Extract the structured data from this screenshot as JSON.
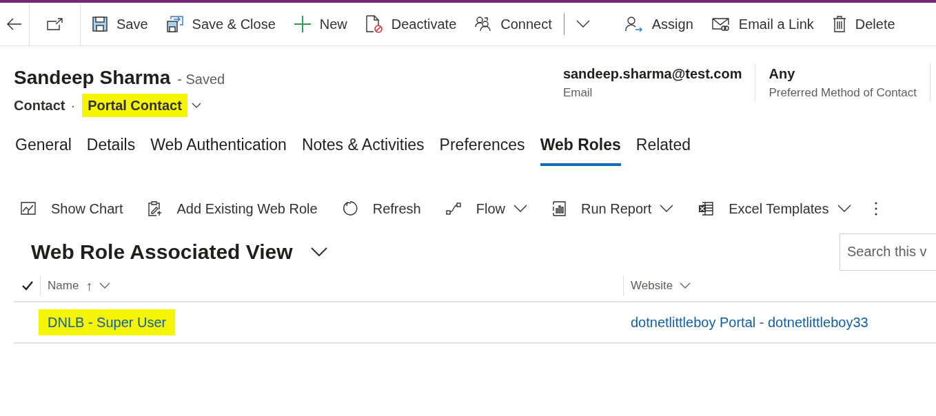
{
  "command_bar": {
    "items": [
      {
        "label": "Save"
      },
      {
        "label": "Save & Close"
      },
      {
        "label": "New"
      },
      {
        "label": "Deactivate"
      },
      {
        "label": "Connect"
      },
      {
        "label": "Assign"
      },
      {
        "label": "Email a Link"
      },
      {
        "label": "Delete"
      }
    ]
  },
  "header": {
    "title": "Sandeep Sharma",
    "status": "- Saved",
    "entity": "Contact",
    "separator": "·",
    "form": "Portal Contact",
    "form_highlighted": true,
    "fields": [
      {
        "value": "sandeep.sharma@test.com",
        "label": "Email"
      },
      {
        "value": "Any",
        "label": "Preferred Method of Contact"
      }
    ]
  },
  "tabs": [
    {
      "label": "General",
      "selected": false
    },
    {
      "label": "Details",
      "selected": false
    },
    {
      "label": "Web Authentication",
      "selected": false
    },
    {
      "label": "Notes & Activities",
      "selected": false
    },
    {
      "label": "Preferences",
      "selected": false
    },
    {
      "label": "Web Roles",
      "selected": true
    },
    {
      "label": "Related",
      "selected": false
    }
  ],
  "subgrid_commands": [
    {
      "label": "Show Chart",
      "dropdown": false
    },
    {
      "label": "Add Existing Web Role",
      "dropdown": false
    },
    {
      "label": "Refresh",
      "dropdown": false
    },
    {
      "label": "Flow",
      "dropdown": true
    },
    {
      "label": "Run Report",
      "dropdown": true
    },
    {
      "label": "Excel Templates",
      "dropdown": true
    }
  ],
  "view": {
    "title": "Web Role Associated View",
    "search": {
      "placeholder": "Search this v"
    }
  },
  "table": {
    "columns": [
      {
        "label": "Name",
        "sort": "↑"
      },
      {
        "label": "Website"
      }
    ],
    "rows": [
      {
        "name": "DNLB - Super User",
        "highlighted": true,
        "website": "dotnetlittleboy Portal - dotnetlittleboy33"
      }
    ]
  }
}
